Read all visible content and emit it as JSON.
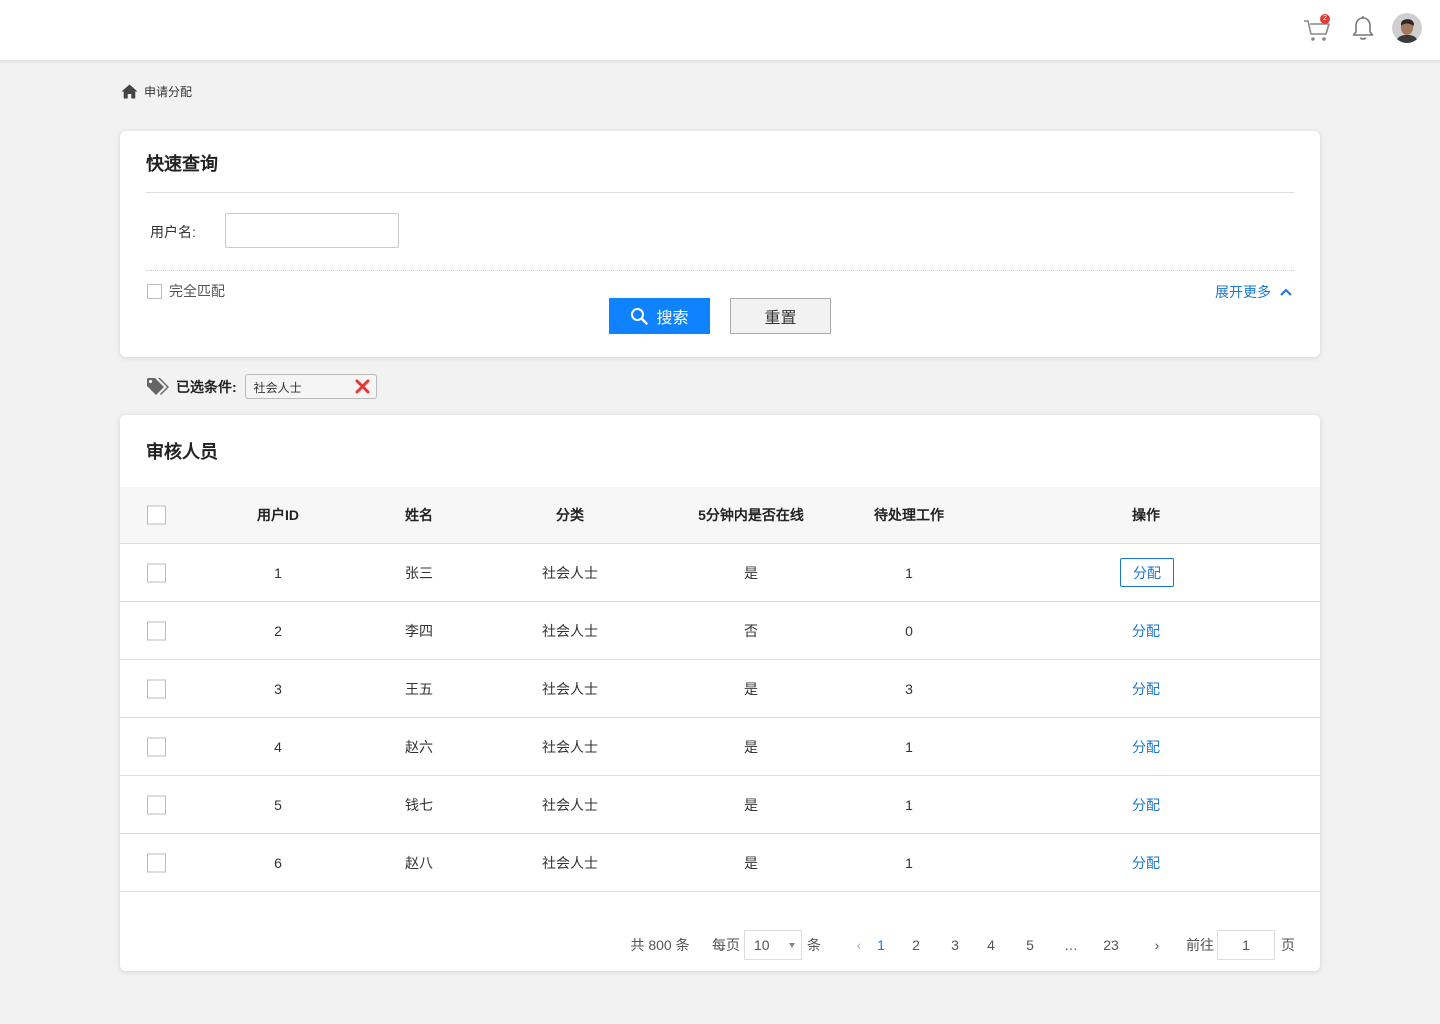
{
  "header": {
    "cart_badge": "2",
    "icons": [
      "cart-icon",
      "bell-icon",
      "avatar"
    ]
  },
  "breadcrumb": {
    "icon": "home-icon",
    "label": "申请分配"
  },
  "search": {
    "title": "快速查询",
    "username_label": "用户名:",
    "username_value": "",
    "exact_match_label": "完全匹配",
    "exact_match_checked": false,
    "search_button": "搜索",
    "reset_button": "重置",
    "expand_label": "展开更多"
  },
  "conditions": {
    "label": "已选条件:",
    "tags": [
      "社会人士"
    ]
  },
  "table": {
    "title": "审核人员",
    "columns": [
      "用户ID",
      "姓名",
      "分类",
      "5分钟内是否在线",
      "待处理工作",
      "操作"
    ],
    "rows": [
      {
        "id": "1",
        "name": "张三",
        "category": "社会人士",
        "online": "是",
        "pending": "1",
        "action": "分配"
      },
      {
        "id": "2",
        "name": "李四",
        "category": "社会人士",
        "online": "否",
        "pending": "0",
        "action": "分配"
      },
      {
        "id": "3",
        "name": "王五",
        "category": "社会人士",
        "online": "是",
        "pending": "3",
        "action": "分配"
      },
      {
        "id": "4",
        "name": "赵六",
        "category": "社会人士",
        "online": "是",
        "pending": "1",
        "action": "分配"
      },
      {
        "id": "5",
        "name": "钱七",
        "category": "社会人士",
        "online": "是",
        "pending": "1",
        "action": "分配"
      },
      {
        "id": "6",
        "name": "赵八",
        "category": "社会人士",
        "online": "是",
        "pending": "1",
        "action": "分配"
      }
    ]
  },
  "pagination": {
    "total": "共 800 条",
    "per_page_label": "每页",
    "page_size": "10",
    "per_page_unit": "条",
    "prev": "‹",
    "pages": [
      "1",
      "2",
      "3",
      "4",
      "5",
      "…",
      "23"
    ],
    "current_page": "1",
    "next": "›",
    "goto_label": "前往",
    "goto_value": "1",
    "goto_unit": "页"
  },
  "colors": {
    "primary": "#0f83ff",
    "link": "#1976d2",
    "badge": "#e53935",
    "close": "#e53935",
    "background": "#f2f2f2"
  }
}
